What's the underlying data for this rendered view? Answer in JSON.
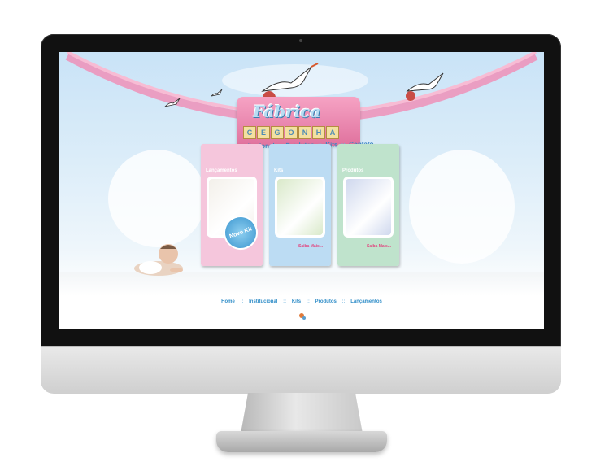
{
  "brand": {
    "name_top": "Fábrica",
    "name_blocks": [
      "C",
      "E",
      "G",
      "O",
      "N",
      "H",
      "A"
    ]
  },
  "top_nav": {
    "items": [
      "Institucional",
      "Produtos",
      "Kits",
      "Contato"
    ],
    "separator": "::"
  },
  "panels": [
    {
      "title": "Lançamentos",
      "badge": "Novo Kit",
      "link": "",
      "color": "#f5c6dc",
      "photo": "#f3f0ea"
    },
    {
      "title": "Kits",
      "badge": "",
      "link": "Saiba Mais...",
      "color": "#bcdcf3",
      "photo": "#d9e9c9"
    },
    {
      "title": "Produtos",
      "badge": "",
      "link": "Saiba Mais...",
      "color": "#bfe3cc",
      "photo": "#cfd8ee"
    }
  ],
  "bottom_nav": {
    "items": [
      "Home",
      "Institucional",
      "Kits",
      "Produtos",
      "Lançamentos"
    ],
    "separator": "::"
  },
  "colors": {
    "accent_pink": "#e0729e",
    "link_blue": "#2f8dc8"
  }
}
